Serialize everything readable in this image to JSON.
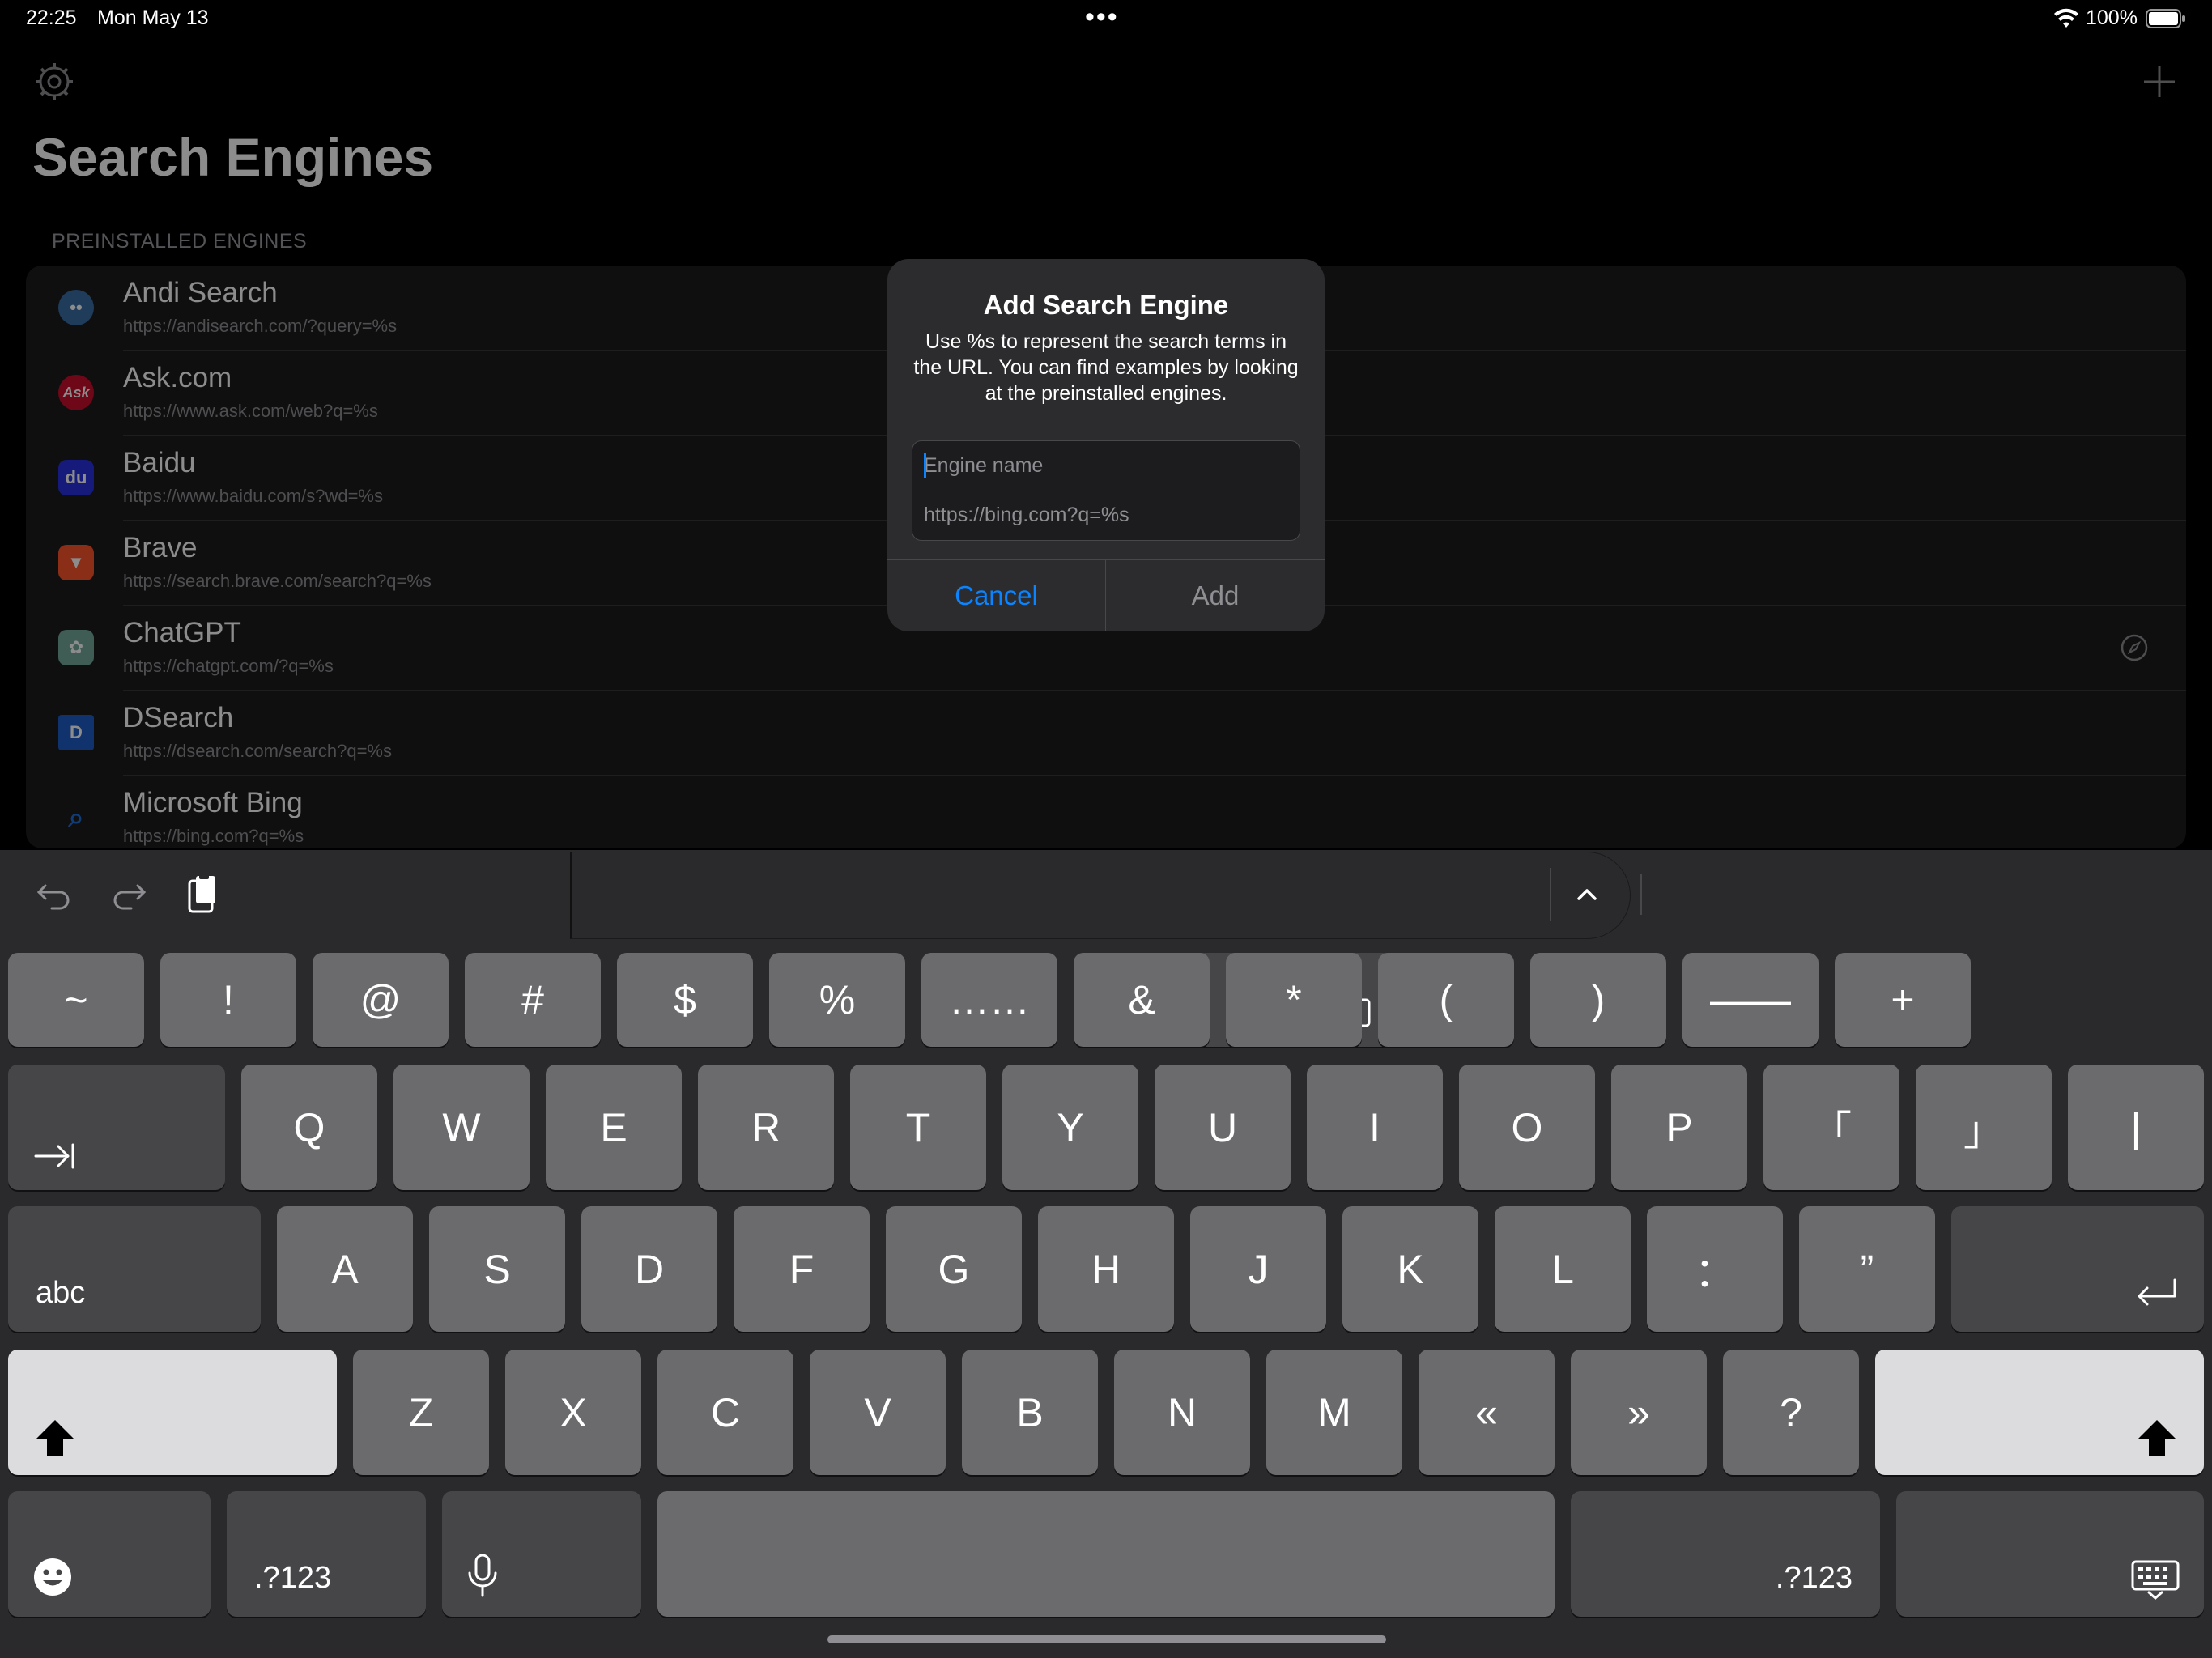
{
  "status_bar": {
    "time": "22:25",
    "date": "Mon May 13",
    "dots": "•••",
    "battery": "100%"
  },
  "app": {
    "title": "Search Engines",
    "section_header": "PREINSTALLED ENGINES",
    "engines": [
      {
        "name": "Andi Search",
        "url": "https://andisearch.com/?query=%s",
        "icon": "andi-icon",
        "icon_text": "••",
        "icon_color": "#3a6ea5"
      },
      {
        "name": "Ask.com",
        "url": "https://www.ask.com/web?q=%s",
        "icon": "ask-icon",
        "icon_text": "Ask",
        "icon_color": "#c8102e"
      },
      {
        "name": "Baidu",
        "url": "https://www.baidu.com/s?wd=%s",
        "icon": "baidu-icon",
        "icon_text": "du",
        "icon_color": "#2932e1"
      },
      {
        "name": "Brave",
        "url": "https://search.brave.com/search?q=%s",
        "icon": "brave-icon",
        "icon_text": "▼",
        "icon_color": "#fb542b"
      },
      {
        "name": "ChatGPT",
        "url": "https://chatgpt.com/?q=%s",
        "icon": "chatgpt-icon",
        "icon_text": "✿",
        "icon_color": "#74aa9c"
      },
      {
        "name": "DSearch",
        "url": "https://dsearch.com/search?q=%s",
        "icon": "dsearch-icon",
        "icon_text": "D",
        "icon_color": "#1e5bc6"
      },
      {
        "name": "Microsoft Bing",
        "url": "https://bing.com?q=%s",
        "icon": "bing-magnifier-icon",
        "icon_text": "⌕",
        "icon_color": "#1e6fd9"
      }
    ]
  },
  "dialog": {
    "title": "Add Search Engine",
    "message": "Use %s to represent the search terms in the URL. You can find examples by looking at the preinstalled engines.",
    "name_placeholder": "Engine name",
    "url_placeholder": "https://bing.com?q=%s",
    "cancel_label": "Cancel",
    "add_label": "Add"
  },
  "keyboard": {
    "row1": [
      "~",
      "!",
      "@",
      "#",
      "$",
      "%",
      "……",
      "&",
      "*",
      "(",
      ")",
      "——",
      "+"
    ],
    "row2": [
      "Q",
      "W",
      "E",
      "R",
      "T",
      "Y",
      "U",
      "I",
      "O",
      "P",
      "「",
      "」",
      "|"
    ],
    "row3": [
      "A",
      "S",
      "D",
      "F",
      "G",
      "H",
      "J",
      "K",
      "L",
      "：",
      "”"
    ],
    "row4": [
      "Z",
      "X",
      "C",
      "V",
      "B",
      "N",
      "M",
      "«",
      "»",
      "?"
    ],
    "abc_label": "abc",
    "numbers_label_left": ".?123",
    "numbers_label_right": ".?123"
  },
  "colors": {
    "accent": "#0a84ff",
    "key": "#6b6b6d",
    "key_dark": "#464648",
    "key_light": "#dcdcde"
  }
}
